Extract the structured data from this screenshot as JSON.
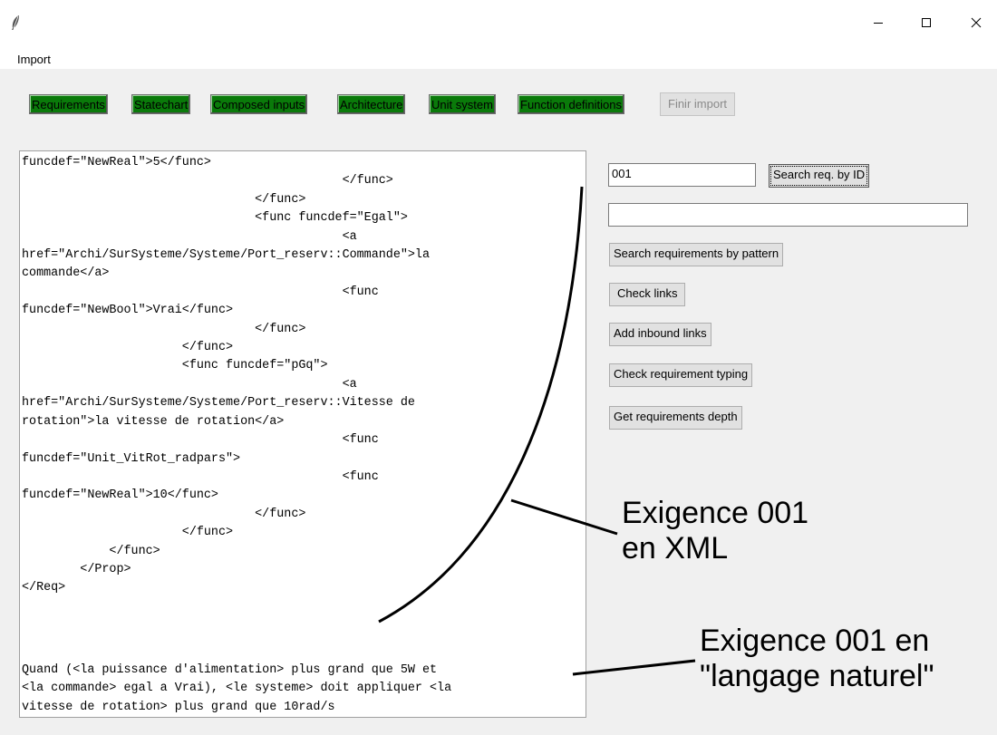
{
  "window": {
    "app_icon": "feather-icon",
    "minimize_icon": "minimize-icon",
    "maximize_icon": "maximize-icon",
    "close_icon": "close-icon"
  },
  "menubar": {
    "import_label": "Import"
  },
  "toolbar": {
    "button_color": "#0a7a0a",
    "buttons": [
      {
        "label": "Requirements"
      },
      {
        "label": "Statechart"
      },
      {
        "label": "Composed inputs"
      },
      {
        "label": "Architecture"
      },
      {
        "label": "Unit system"
      },
      {
        "label": "Function definitions"
      }
    ],
    "finish_label": "Finir import"
  },
  "text_panel": {
    "xml_text": "funcdef=\"NewReal\">5</func>\n                                            </func>\n                                </func>\n                                <func funcdef=\"Egal\">\n                                            <a\nhref=\"Archi/SurSysteme/Systeme/Port_reserv::Commande\">la\ncommande</a>\n                                            <func\nfuncdef=\"NewBool\">Vrai</func>\n                                </func>\n                      </func>\n                      <func funcdef=\"pGq\">\n                                            <a\nhref=\"Archi/SurSysteme/Systeme/Port_reserv::Vitesse de\nrotation\">la vitesse de rotation</a>\n                                            <func\nfuncdef=\"Unit_VitRot_radpars\">\n                                            <func\nfuncdef=\"NewReal\">10</func>\n                                </func>\n                      </func>\n            </func>\n        </Prop>\n</Req>",
    "natural_text": "Quand (<la puissance d'alimentation> plus grand que 5W et\n<la commande> egal a Vrai), <le systeme> doit appliquer <la\nvitesse de rotation> plus grand que 10rad/s"
  },
  "side_panel": {
    "id_input_value": "001",
    "search_id_label": "Search req. by ID",
    "pattern_input_value": "",
    "search_pattern_label": "Search requirements by pattern",
    "check_links_label": "Check links",
    "add_inbound_label": "Add inbound links",
    "check_typing_label": "Check requirement typing",
    "depth_label": "Get requirements depth"
  },
  "annotations": {
    "xml_line1": "Exigence 001",
    "xml_line2": "en XML",
    "nl_line1": "Exigence 001 en",
    "nl_line2": "\"langage naturel\""
  }
}
